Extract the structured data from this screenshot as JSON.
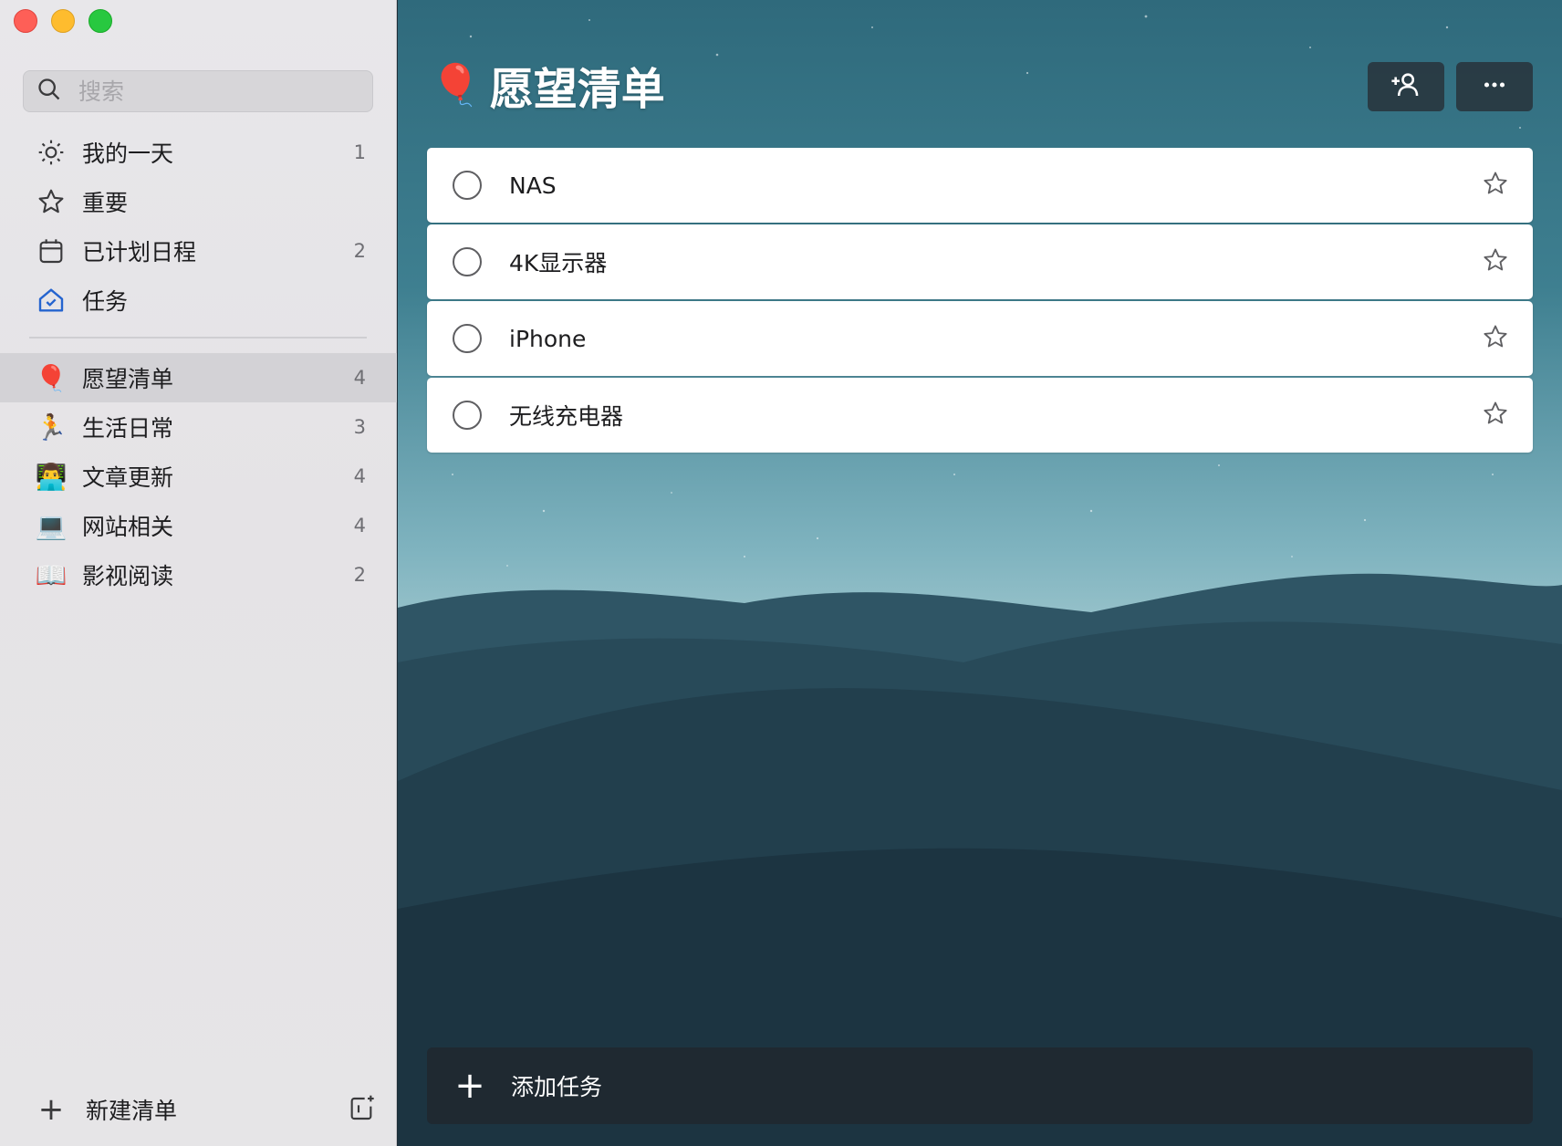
{
  "search": {
    "placeholder": "搜索"
  },
  "smart_lists": [
    {
      "icon": "sun-icon",
      "label": "我的一天",
      "count": "1"
    },
    {
      "icon": "star-icon",
      "label": "重要",
      "count": ""
    },
    {
      "icon": "calendar-icon",
      "label": "已计划日程",
      "count": "2"
    },
    {
      "icon": "home-task-icon",
      "label": "任务",
      "count": ""
    }
  ],
  "lists": [
    {
      "emoji": "🎈",
      "label": "愿望清单",
      "count": "4",
      "selected": true
    },
    {
      "emoji": "🏃",
      "label": "生活日常",
      "count": "3"
    },
    {
      "emoji": "👨‍💻",
      "label": "文章更新",
      "count": "4"
    },
    {
      "emoji": "💻",
      "label": "网站相关",
      "count": "4"
    },
    {
      "emoji": "📖",
      "label": "影视阅读",
      "count": "2"
    }
  ],
  "footer": {
    "new_list_label": "新建清单"
  },
  "main": {
    "title_emoji": "🎈",
    "title": "愿望清单",
    "tasks": [
      {
        "text": "NAS"
      },
      {
        "text": "4K显示器"
      },
      {
        "text": "iPhone"
      },
      {
        "text": "无线充电器"
      }
    ],
    "add_task_label": "添加任务"
  },
  "colors": {
    "accent": "#2564cf",
    "sidebar_bg": "#e6e5e7",
    "selected_bg": "#d3d2d6"
  }
}
